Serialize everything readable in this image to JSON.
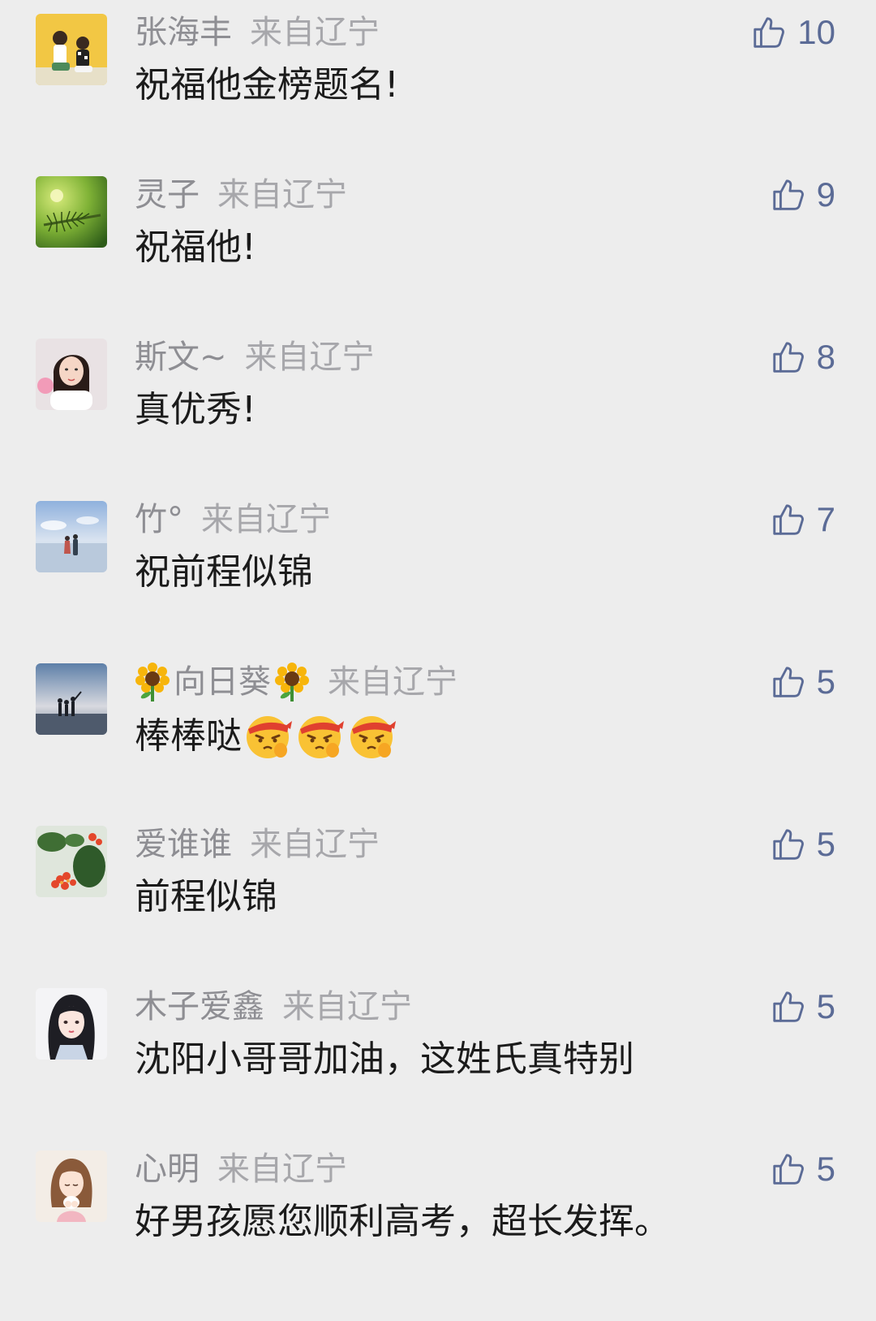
{
  "colors": {
    "background": "#ededed",
    "author": "#8e8e93",
    "location": "#a7a7ab",
    "text": "#1b1b1b",
    "like": "#5b6b96"
  },
  "like_icon": "thumbs-up-icon",
  "comments": [
    {
      "author": "张海丰",
      "location": "来自辽宁",
      "text": "祝福他金榜题名!",
      "likes": "10",
      "avatar": "two-children-avatar"
    },
    {
      "author": "灵子",
      "location": "来自辽宁",
      "text": "祝福他!",
      "likes": "9",
      "avatar": "pine-branch-avatar"
    },
    {
      "author": "斯文~",
      "location": "来自辽宁",
      "text": "真优秀!",
      "likes": "8",
      "avatar": "woman-portrait-avatar"
    },
    {
      "author": "竹°",
      "location": "来自辽宁",
      "text": "祝前程似锦",
      "likes": "7",
      "avatar": "beach-couple-avatar"
    },
    {
      "author": "向日葵",
      "author_prefix_icon": "sunflower-emoji",
      "author_suffix_icon": "sunflower-emoji",
      "location": "来自辽宁",
      "text": "棒棒哒",
      "text_emojis": [
        "determined-face-emoji",
        "determined-face-emoji",
        "determined-face-emoji"
      ],
      "likes": "5",
      "avatar": "sunset-silhouettes-avatar"
    },
    {
      "author": "爱谁谁",
      "location": "来自辽宁",
      "text": "前程似锦",
      "likes": "5",
      "avatar": "red-flowers-avatar"
    },
    {
      "author": "木子爱鑫",
      "location": "来自辽宁",
      "text": "沈阳小哥哥加油，这姓氏真特别",
      "likes": "5",
      "avatar": "anime-girl-avatar"
    },
    {
      "author": "心明",
      "location": "来自辽宁",
      "text": "好男孩愿您顺利高考，超长发挥。",
      "likes": "5",
      "avatar": "illustrated-girl-avatar"
    }
  ]
}
